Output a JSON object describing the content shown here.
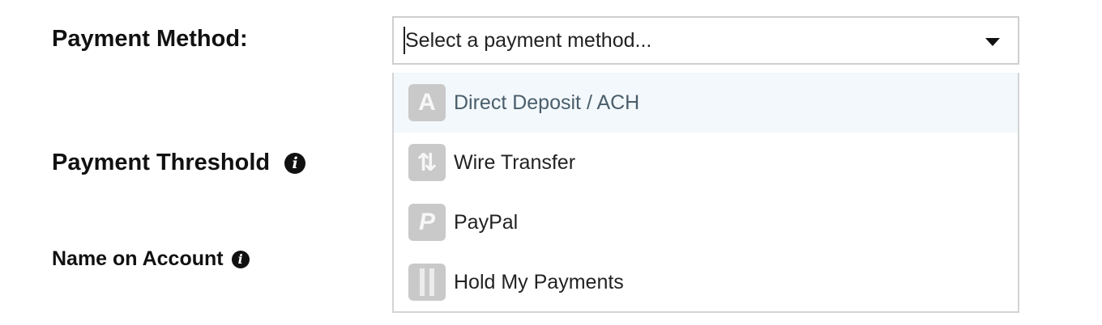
{
  "form": {
    "payment_method_label": "Payment Method:",
    "payment_threshold_label": "Payment Threshold",
    "name_on_account_label": "Name on Account"
  },
  "select": {
    "placeholder": "Select a payment method..."
  },
  "dropdown": {
    "options": [
      {
        "label": "Direct Deposit / ACH",
        "icon_text": "A",
        "icon": "ach-icon",
        "highlighted": true
      },
      {
        "label": "Wire Transfer",
        "icon_text": "⇅",
        "icon": "wire-transfer-icon",
        "highlighted": false
      },
      {
        "label": "PayPal",
        "icon_text": "P",
        "icon": "paypal-icon",
        "highlighted": false
      },
      {
        "label": "Hold My Payments",
        "icon_text": "",
        "icon": "hold-payments-icon",
        "highlighted": false
      }
    ]
  },
  "icons": {
    "info_glyph": "i"
  },
  "colors": {
    "highlight_bg": "#f2f8fb",
    "icon_bg": "#c9c9c9",
    "border": "#cfcfcf"
  }
}
